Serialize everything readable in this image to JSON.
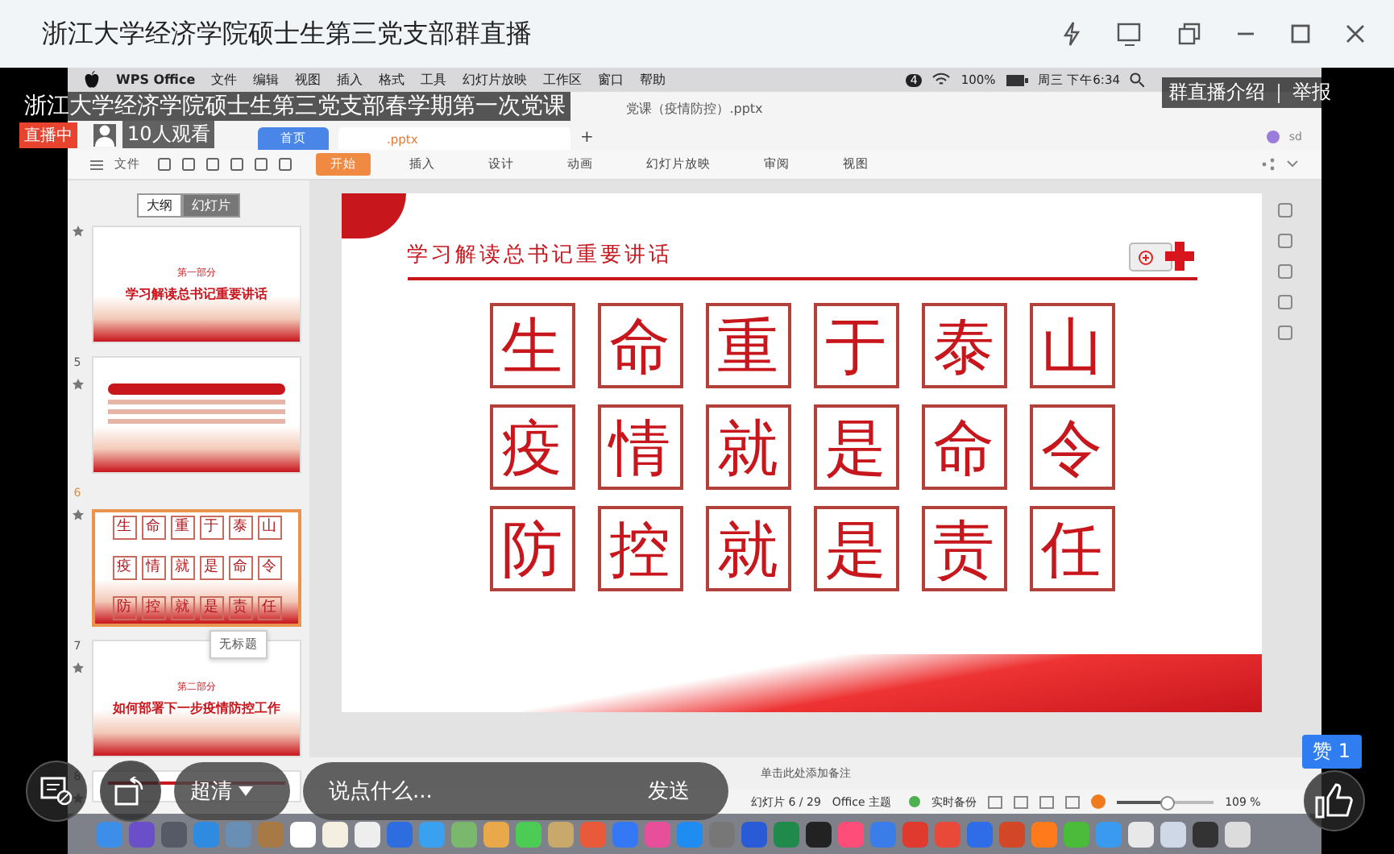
{
  "window": {
    "title": "浙江大学经济学院硕士生第三党支部群直播"
  },
  "live": {
    "title": "浙江大学经济学院硕士生第三党支部春学期第一次党课",
    "status": "直播中",
    "viewers": "10人观看",
    "links": [
      "群直播介绍",
      "举报"
    ]
  },
  "mac_menu": {
    "app": "WPS Office",
    "items": [
      "文件",
      "编辑",
      "视图",
      "插入",
      "格式",
      "工具",
      "幻灯片放映",
      "工作区",
      "窗口",
      "帮助"
    ],
    "badge": "4",
    "battery": "100%",
    "clock": "周三 下午6:34"
  },
  "wps": {
    "doc_title": "党课（疫情防控）.pptx",
    "tabs": [
      {
        "kind": "home",
        "label": "首页"
      },
      {
        "kind": "file",
        "label": ".pptx"
      }
    ],
    "new_tab": "+",
    "user": "sd",
    "menu": "文件",
    "ribbon_tabs": [
      {
        "label": "开始",
        "selected": true
      },
      {
        "label": "插入",
        "selected": false
      },
      {
        "label": "设计",
        "selected": false
      },
      {
        "label": "动画",
        "selected": false
      },
      {
        "label": "幻灯片放映",
        "selected": false
      },
      {
        "label": "审阅",
        "selected": false
      },
      {
        "label": "视图",
        "selected": false
      }
    ]
  },
  "panel": {
    "tabs": [
      {
        "label": "大纲",
        "selected": false
      },
      {
        "label": "幻灯片",
        "selected": true
      }
    ],
    "thumbnails": [
      {
        "kind": "section",
        "part": "第一部分",
        "heading": "学习解读总书记重要讲话",
        "selected": false
      },
      {
        "number": "5",
        "kind": "text",
        "selected": false
      },
      {
        "number": "6",
        "kind": "grid",
        "rows": [
          "生命重于泰山",
          "疫情就是命令",
          "防控就是责任"
        ],
        "selected": true
      },
      {
        "number": "7",
        "kind": "section",
        "part": "第二部分",
        "heading": "如何部署下一步疫情防控工作",
        "selected": false
      },
      {
        "number": "8",
        "kind": "header",
        "selected": false
      }
    ],
    "tooltip": "无标题"
  },
  "slide": {
    "title": "学习解读总书记重要讲话",
    "rows": [
      "生命重于泰山",
      "疫情就是命令",
      "防控就是责任"
    ]
  },
  "notes": {
    "placeholder": "单击此处添加备注"
  },
  "status_bar": {
    "slide": "幻灯片 6 / 29",
    "theme": "Office 主题",
    "backup": "实时备份",
    "zoom_slider": {
      "level": 0.52
    },
    "zoom": "109 %"
  },
  "stream_controls": {
    "quality": "超清",
    "comment": {
      "placeholder": "说点什么..."
    },
    "send": "发送",
    "likes": "赞 1"
  }
}
